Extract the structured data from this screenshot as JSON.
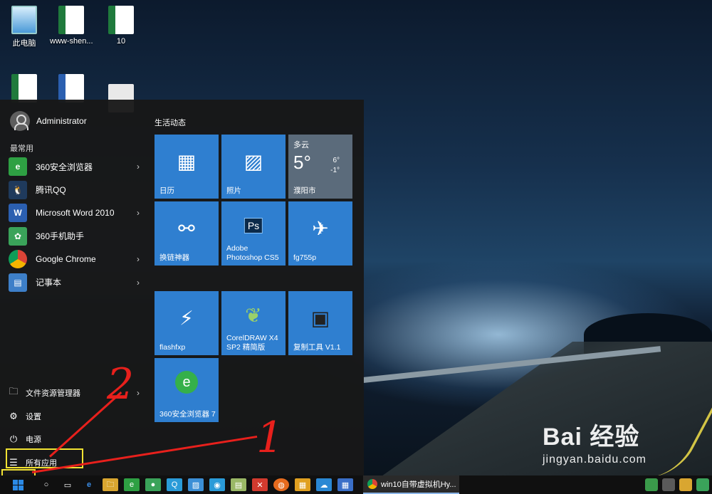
{
  "desktop": {
    "icons": [
      {
        "label": "此电脑",
        "icon": "computer-icon"
      },
      {
        "label": "www-shen...",
        "icon": "excel-file-icon"
      },
      {
        "label": "10",
        "icon": "excel-file-icon"
      },
      {
        "label": "",
        "icon": "excel-file-icon"
      },
      {
        "label": "",
        "icon": "word-file-icon"
      },
      {
        "label": "",
        "icon": "document-icon"
      }
    ]
  },
  "start_menu": {
    "user": "Administrator",
    "most_used_label": "最常用",
    "apps": [
      {
        "label": "360安全浏览器",
        "icon": "360-browser-icon",
        "color": "#2ea043",
        "submenu": true
      },
      {
        "label": "腾讯QQ",
        "icon": "qq-icon",
        "color": "#1f3a5c",
        "submenu": false
      },
      {
        "label": "Microsoft Word 2010",
        "icon": "word-icon",
        "color": "#2b5fb0",
        "submenu": true
      },
      {
        "label": "360手机助手",
        "icon": "360-phone-assistant-icon",
        "color": "#3aa35a",
        "submenu": false
      },
      {
        "label": "Google Chrome",
        "icon": "chrome-icon",
        "color": "#e0e0e0",
        "submenu": true
      },
      {
        "label": "记事本",
        "icon": "notepad-icon",
        "color": "#3d7fc8",
        "submenu": true
      }
    ],
    "bottom": [
      {
        "label": "文件资源管理器",
        "icon": "file-explorer-icon",
        "glyph": "🗀",
        "submenu": true
      },
      {
        "label": "设置",
        "icon": "settings-gear-icon",
        "glyph": "⚙",
        "submenu": false
      },
      {
        "label": "电源",
        "icon": "power-icon",
        "glyph": "⏻",
        "submenu": false
      },
      {
        "label": "所有应用",
        "icon": "all-apps-list-icon",
        "glyph": "☰",
        "submenu": false
      }
    ],
    "tile_group": "生活动态",
    "tiles": [
      {
        "label": "日历",
        "icon": "calendar-icon",
        "glyph": "▦"
      },
      {
        "label": "照片",
        "icon": "photos-icon",
        "glyph": "▨"
      },
      {
        "label": "换链神器",
        "icon": "chain-link-icon",
        "glyph": "⚯"
      },
      {
        "label": "Adobe Photoshop CS5",
        "icon": "photoshop-icon",
        "glyph": "Ps"
      },
      {
        "label": "fg755p",
        "icon": "bird-app-icon",
        "glyph": "✈"
      },
      {
        "label": "flashfxp",
        "icon": "flashfxp-icon",
        "glyph": "⚡"
      },
      {
        "label": "CorelDRAW X4 SP2 精简版",
        "icon": "coreldraw-icon",
        "glyph": "❦"
      },
      {
        "label": "复制工具 V1.1",
        "icon": "copy-tool-icon",
        "glyph": "▣"
      },
      {
        "label": "360安全浏览器 7",
        "icon": "360-browser-icon",
        "glyph": "e"
      }
    ],
    "weather": {
      "condition": "多云",
      "temp": "5°",
      "high": "6°",
      "low": "-1°",
      "city": "濮阳市"
    }
  },
  "annotations": {
    "one": "1",
    "two": "2"
  },
  "taskbar": {
    "icons": [
      {
        "icon": "search-icon",
        "glyph": "○",
        "color": "transparent"
      },
      {
        "icon": "task-view-icon",
        "glyph": "▭",
        "color": "transparent"
      },
      {
        "icon": "edge-icon",
        "glyph": "e",
        "color": "transparent"
      },
      {
        "icon": "file-explorer-icon",
        "glyph": "🗀",
        "color": "#d9a630"
      },
      {
        "icon": "360-browser-icon",
        "glyph": "e",
        "color": "#2ea043"
      },
      {
        "icon": "wechat-icon",
        "glyph": "●",
        "color": "#3aa35a"
      },
      {
        "icon": "qq-icon",
        "glyph": "Q",
        "color": "#2a9bd8"
      },
      {
        "icon": "image-viewer-icon",
        "glyph": "▨",
        "color": "#3b8fd6"
      },
      {
        "icon": "chat-icon",
        "glyph": "◉",
        "color": "#2a9bd8"
      },
      {
        "icon": "notes-icon",
        "glyph": "▤",
        "color": "#9ab866"
      },
      {
        "icon": "tool-icon",
        "glyph": "✕",
        "color": "#d23a2e"
      },
      {
        "icon": "firefox-icon",
        "glyph": "◍",
        "color": "#e66b1e"
      },
      {
        "icon": "gift-icon",
        "glyph": "▦",
        "color": "#e0a020"
      },
      {
        "icon": "cloud-icon",
        "glyph": "☁",
        "color": "#2a88d4"
      },
      {
        "icon": "grid-app-icon",
        "glyph": "▦",
        "color": "#3a6fc8"
      }
    ],
    "window_title": "win10自带虚拟机Hy...",
    "tray_icons": [
      "shield-icon",
      "network-icon",
      "volume-icon",
      "wechat-tray-icon"
    ]
  },
  "watermark": {
    "main": "Bai 经验",
    "sub": "jingyan.baidu.com"
  }
}
